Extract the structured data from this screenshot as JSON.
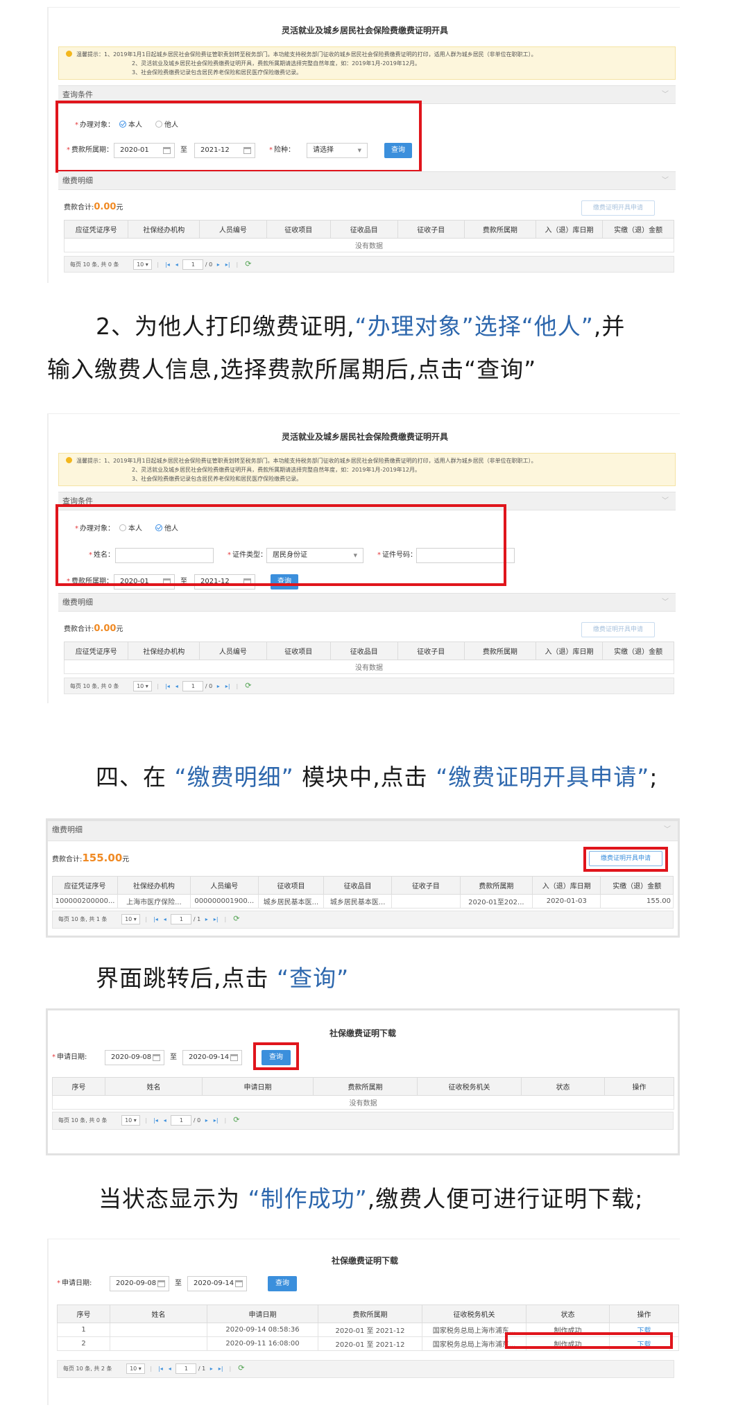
{
  "colors": {
    "accent": "#3b8fdc",
    "highlight": "#e0151c",
    "amount": "#f08a24",
    "prose_highlight": "#2d67ad"
  },
  "shot1": {
    "title": "灵活就业及城乡居民社会保险费缴费证明开具",
    "tip": {
      "line1": "温馨提示：1、2019年1月1日起城乡居民社会保险费征管职责划转至税务部门。本功能支持税务部门征收的城乡居民社会保险费缴费证明的打印，适用人群为城乡居民（非单位在职职工）。",
      "line2": "2、灵活就业及城乡居民社会保险费缴费证明开具，费款所属期请选择完整自然年度，如：2019年1月-2019年12月。",
      "line3": "3、社会保险费缴费记录包含居民养老保险和居民医疗保险缴费记录。"
    },
    "query_section": "查询条件",
    "target_label": "办理对象：",
    "radio_self": "本人",
    "radio_other": "他人",
    "period_label": "费款所属期：",
    "period_from": "2020-01",
    "to_label": "至",
    "period_to": "2021-12",
    "insurance_label": "险种：",
    "insurance_value": "请选择",
    "query_btn": "查询",
    "detail_section": "缴费明细",
    "total_label": "费款合计:",
    "total_amount": "0.00",
    "total_unit": "元",
    "apply_btn": "缴费证明开具申请",
    "no_data": "没有数据",
    "pager": {
      "info": "每页 10 条, 共 0 条",
      "size": "10",
      "page": "1",
      "total": "/ 0"
    }
  },
  "payment_headers": [
    "应征凭证序号",
    "社保经办机构",
    "人员编号",
    "征收项目",
    "征收品目",
    "征收子目",
    "费款所属期",
    "入（退）库日期",
    "实缴（退）金额"
  ],
  "prose1": {
    "indent_text": "2、为他人打印缴费证明,",
    "hl1": "“办理对象”选择“他人”",
    "after": ",并",
    "line2": "输入缴费人信息,选择费款所属期后,点击“查询”"
  },
  "shot2": {
    "name_label": "姓名：",
    "cert_type_label": "证件类型：",
    "cert_type_value": "居民身份证",
    "cert_no_label": "证件号码："
  },
  "prose2": {
    "pre": "四、在 ",
    "hl1": "“缴费明细”",
    "mid": " 模块中,点击 ",
    "hl2": "“缴费证明开具申请”",
    "post": ";"
  },
  "shot3": {
    "total_amount": "155.00",
    "row": [
      "100000200000...",
      "上海市医疗保险...",
      "000000001900...",
      "城乡居民基本医...",
      "城乡居民基本医...",
      "",
      "2020-01至202...",
      "2020-01-03",
      "155.00"
    ],
    "pager": {
      "info": "每页 10 条, 共 1 条",
      "size": "10",
      "page": "1",
      "total": "/ 1"
    }
  },
  "prose3": {
    "pre": "界面跳转后,点击 ",
    "hl1": "“查询”"
  },
  "download_title": "社保缴费证明下载",
  "apply_date_label": "申请日期:",
  "apply_from": "2020-09-08",
  "apply_to": "2020-09-14",
  "download_headers": [
    "序号",
    "姓名",
    "申请日期",
    "费款所属期",
    "征收税务机关",
    "状态",
    "操作"
  ],
  "prose4": {
    "pre": "当状态显示为 ",
    "hl1": "“制作成功”",
    "post": ",缴费人便可进行证明下载;"
  },
  "shot5": {
    "rows": [
      [
        "1",
        "",
        "2020-09-14 08:58:36",
        "2020-01 至 2021-12",
        "国家税务总局上海市浦东...",
        "制作成功",
        "下载"
      ],
      [
        "2",
        "",
        "2020-09-11 16:08:00",
        "2020-01 至 2021-12",
        "国家税务总局上海市浦东...",
        "制作成功",
        "下载"
      ]
    ],
    "pager": {
      "info": "每页 10 条, 共 2 条",
      "size": "10",
      "page": "1",
      "total": "/ 1"
    }
  }
}
